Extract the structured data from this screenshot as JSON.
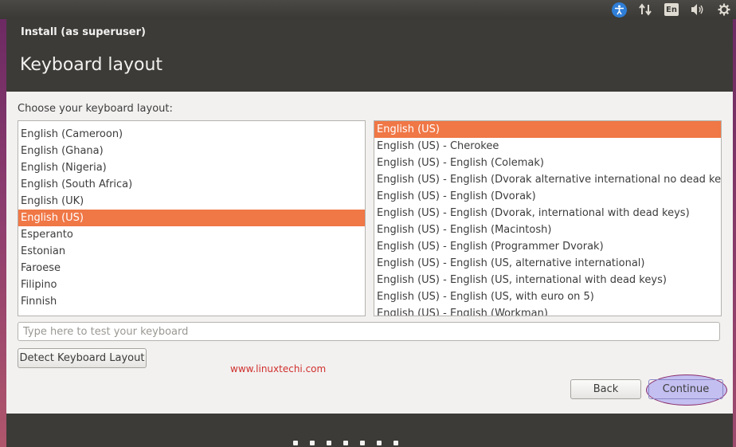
{
  "top_panel": {
    "icons": [
      "accessibility-icon",
      "network-icon",
      "keyboard-language-indicator",
      "volume-icon",
      "settings-gear-icon"
    ],
    "language_indicator": "En"
  },
  "window": {
    "title": "Install (as superuser)",
    "heading": "Keyboard layout",
    "prompt": "Choose your keyboard layout:"
  },
  "layouts": {
    "selected": "English (US)",
    "items": [
      "English (Cameroon)",
      "English (Ghana)",
      "English (Nigeria)",
      "English (South Africa)",
      "English (UK)",
      "English (US)",
      "Esperanto",
      "Estonian",
      "Faroese",
      "Filipino",
      "Finnish"
    ]
  },
  "variants": {
    "selected": "English (US)",
    "items": [
      "English (US)",
      "English (US) - Cherokee",
      "English (US) - English (Colemak)",
      "English (US) - English (Dvorak alternative international no dead keys)",
      "English (US) - English (Dvorak)",
      "English (US) - English (Dvorak, international with dead keys)",
      "English (US) - English (Macintosh)",
      "English (US) - English (Programmer Dvorak)",
      "English (US) - English (US, alternative international)",
      "English (US) - English (US, international with dead keys)",
      "English (US) - English (US, with euro on 5)",
      "English (US) - English (Workman)"
    ]
  },
  "test_input": {
    "placeholder": "Type here to test your keyboard",
    "value": ""
  },
  "buttons": {
    "detect": "Detect Keyboard Layout",
    "back": "Back",
    "continue": "Continue"
  },
  "watermark": "www.linuxtechi.com",
  "progress": {
    "total_steps": 7
  },
  "colors": {
    "selection": "#f07746",
    "window_chrome": "#3c3b37",
    "content_bg": "#f2f1f0",
    "watermark": "#d0302d",
    "highlight": "#9d96f0"
  }
}
